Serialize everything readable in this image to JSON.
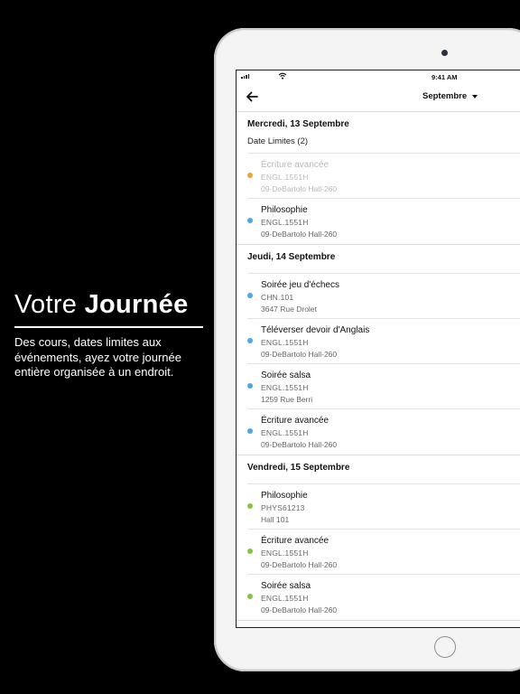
{
  "promo": {
    "title_light": "Votre ",
    "title_bold": "Journée",
    "description": "Des cours, dates limites aux événements, ayez votre journée entière organisée à un endroit."
  },
  "statusbar": {
    "time": "9:41 AM"
  },
  "navbar": {
    "month": "Septembre"
  },
  "days": [
    {
      "header": "Mercredi, 13 Septembre",
      "subheader": "Date Limites (2)",
      "events": [
        {
          "title": "Écriture avancée",
          "code": "ENGL.1551H",
          "location": "09-DeBartolo Hall-260",
          "color": "#f0a23a",
          "faded": true
        },
        {
          "title": "Philosophie",
          "code": "ENGL.1551H",
          "location": "09-DeBartolo Hall-260",
          "color": "#4aa8e8",
          "faded": false
        }
      ]
    },
    {
      "header": "Jeudi, 14 Septembre",
      "events": [
        {
          "title": "Soirée jeu d'échecs",
          "code": "CHN.101",
          "location": "3647 Rue Drolet",
          "color": "#4aa8e8"
        },
        {
          "title": "Téléverser devoir d'Anglais",
          "code": "ENGL.1551H",
          "location": "09-DeBartolo Hall-260",
          "color": "#4aa8e8"
        },
        {
          "title": "Soirée salsa",
          "code": "ENGL.1551H",
          "location": "1259 Rue Berri",
          "color": "#4aa8e8"
        },
        {
          "title": "Écriture avancée",
          "code": "ENGL.1551H",
          "location": "09-DeBartolo Hall-260",
          "color": "#4aa8e8"
        }
      ]
    },
    {
      "header": "Vendredi, 15 Septembre",
      "events": [
        {
          "title": "Philosophie",
          "code": "PHYS61213",
          "location": "Hall 101",
          "color": "#86c440"
        },
        {
          "title": "Écriture avancée",
          "code": "ENGL.1551H",
          "location": "09-DeBartolo Hall-260",
          "color": "#86c440"
        },
        {
          "title": "Soirée salsa",
          "code": "ENGL.1551H",
          "location": "09-DeBartolo Hall-260",
          "color": "#86c440"
        }
      ]
    }
  ]
}
